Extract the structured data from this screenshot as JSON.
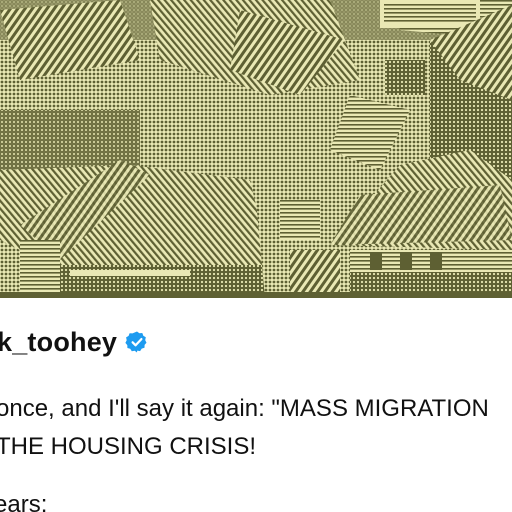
{
  "image": {
    "icon": "photo-house-rooftops"
  },
  "author": {
    "username": "k_toohey",
    "verified_icon": "verified-badge-icon",
    "badge_color": "#1d9bf0"
  },
  "post": {
    "line1": "once, and I'll say it again: \"MASS MIGRATION",
    "line2": "THE HOUSING CRISIS!",
    "line3": "ears:"
  },
  "colors": {
    "photo_light": "#e9e8b4",
    "photo_dark": "#5e6033"
  }
}
